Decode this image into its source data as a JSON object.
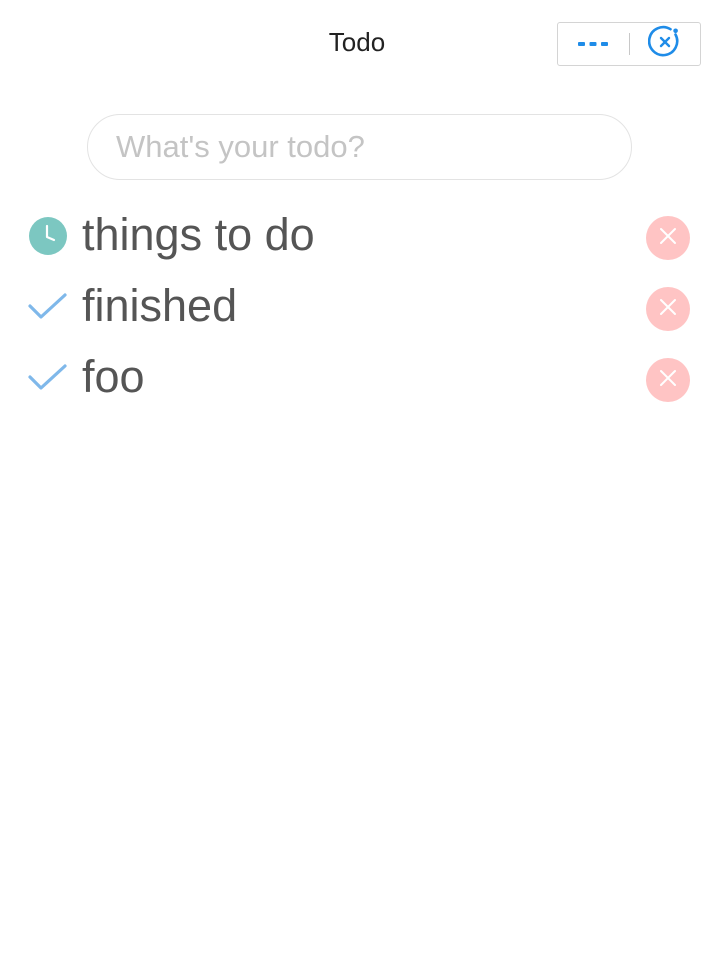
{
  "nav": {
    "title": "Todo",
    "menu_icon": "more-dots-icon",
    "close_icon": "close-circle-icon",
    "accent_color": "#1f8ce8"
  },
  "input": {
    "placeholder": "What's your todo?",
    "value": ""
  },
  "todos": [
    {
      "text": "things to do",
      "status": "pending",
      "status_icon": "clock-icon",
      "delete_icon": "close-icon"
    },
    {
      "text": "finished",
      "status": "done",
      "status_icon": "check-icon",
      "delete_icon": "close-icon"
    },
    {
      "text": "foo",
      "status": "done",
      "status_icon": "check-icon",
      "delete_icon": "close-icon"
    }
  ],
  "colors": {
    "pending": "#7cc7c1",
    "done": "#7fb8ea",
    "delete_bg": "#ffc4c4",
    "text": "#555555"
  }
}
